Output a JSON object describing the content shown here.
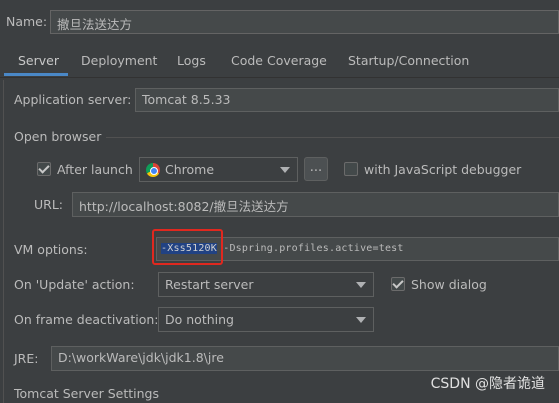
{
  "name": {
    "label": "Name:",
    "value": "撤旦法送达方"
  },
  "tabs": [
    {
      "label": "Server",
      "active": true
    },
    {
      "label": "Deployment"
    },
    {
      "label": "Logs"
    },
    {
      "label": "Code Coverage"
    },
    {
      "label": "Startup/Connection"
    }
  ],
  "app_server": {
    "label": "Application server:",
    "value": "Tomcat 8.5.33"
  },
  "open_browser": {
    "title": "Open browser",
    "after_launch_label": "After launch",
    "after_launch_checked": true,
    "browser_value": "Chrome",
    "browse_button": "...",
    "js_debugger_label": "with JavaScript debugger",
    "js_debugger_checked": false,
    "url_label": "URL:",
    "url_value": "http://localhost:8082/撤旦法送达方"
  },
  "vm_options": {
    "label": "VM options:",
    "highlighted": "-Xss5120K",
    "rest": " -Dspring.profiles.active=test"
  },
  "on_update": {
    "label": "On 'Update' action:",
    "value": "Restart server",
    "show_dialog_label": "Show dialog",
    "show_dialog_checked": true
  },
  "on_frame": {
    "label": "On frame deactivation:",
    "value": "Do nothing"
  },
  "jre": {
    "label": "JRE:",
    "value": "D:\\workWare\\jdk\\jdk1.8\\jre"
  },
  "tomcat_settings": {
    "title": "Tomcat Server Settings"
  },
  "watermark": "CSDN @隐者诡道",
  "colors": {
    "accent": "#4a88c7",
    "highlight_box": "#e0281f",
    "background": "#3c3f41"
  }
}
